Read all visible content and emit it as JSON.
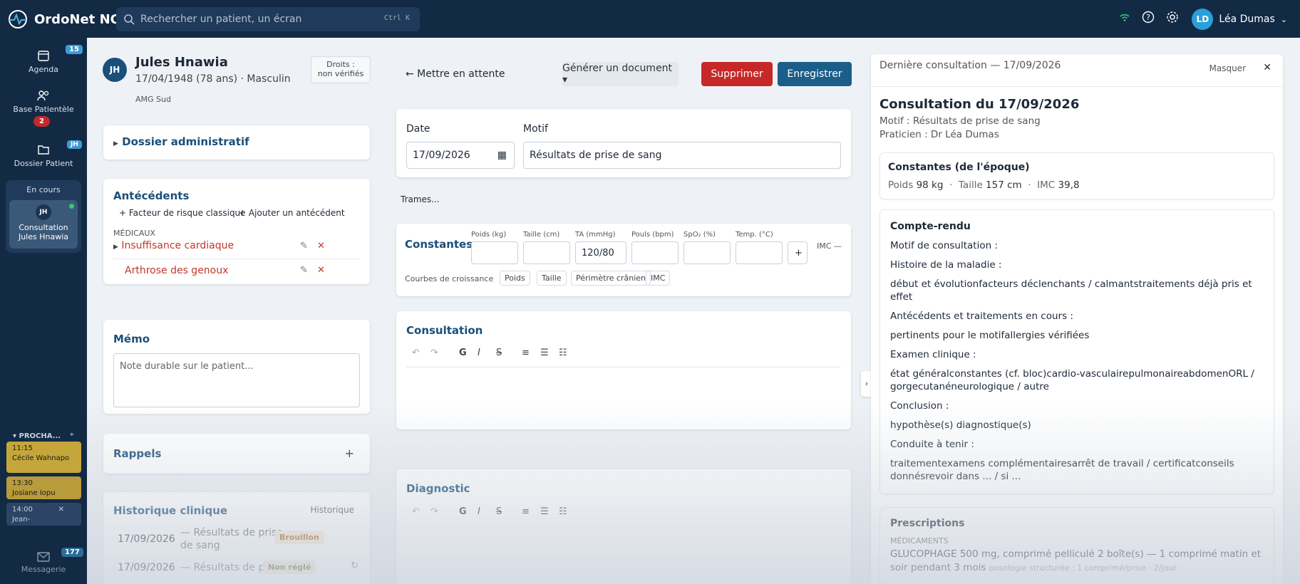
{
  "app": {
    "title": "OrdoNet NC",
    "search_placeholder": "Rechercher un patient, un écran",
    "search_kbd": "Ctrl K",
    "user_initials": "LD",
    "user_name": "Léa Dumas"
  },
  "sidebar": {
    "agenda": "Agenda",
    "agenda_badge": "15",
    "base": "Base Patientèle",
    "base_badge": "2",
    "dossier": "Dossier Patient",
    "dossier_badge": "JH",
    "en_cours": "En cours",
    "current_initials": "JH",
    "current_label1": "Consultation",
    "current_label2": "Jules Hnawia",
    "next_title": "▾ PROCHA...",
    "appointments": [
      {
        "time": "11:15",
        "name": "Cécile Wahnapo"
      },
      {
        "time": "13:30",
        "name": "Josiane Iopu"
      },
      {
        "time": "14:00",
        "name": "Jean-"
      }
    ],
    "messagerie": "Messagerie",
    "messagerie_badge": "177"
  },
  "patient": {
    "initials": "JH",
    "name": "Jules Hnawia",
    "dob": "17/04/1948 (78 ans) · Masculin",
    "coverage": "AMG Sud",
    "rights_label": "Droits :",
    "rights_value": "non vérifiés"
  },
  "left": {
    "dossier_admin": "Dossier administratif",
    "antecedents_title": "Antécédents",
    "add_risk": "+ Facteur de risque classique",
    "add_ante": "+ Ajouter un antécédent",
    "medicaux": "MÉDICAUX",
    "ante1": "Insuffisance cardiaque",
    "ante2": "Arthrose des genoux",
    "memo_title": "Mémo",
    "memo_placeholder": "Note durable sur le patient...",
    "rappels": "Rappels",
    "historique_title": "Historique clinique",
    "historique_link": "Historique",
    "hist": [
      {
        "date": "17/09/2026",
        "text": "— Résultats de prise de sang",
        "status": "Brouillon"
      },
      {
        "date": "17/09/2026",
        "text": "— Résultats de pri...",
        "status": "Non réglé"
      }
    ]
  },
  "center": {
    "hold": "← Mettre en attente",
    "generate": "Générer un document ▾",
    "delete": "Supprimer",
    "save": "Enregistrer",
    "date_label": "Date",
    "date_value": "17/09/2026",
    "motif_label": "Motif",
    "motif_value": "Résultats de prise de sang",
    "trames": "Trames...",
    "constantes_title": "Constantes",
    "const_labels": [
      "Poids (kg)",
      "Taille (cm)",
      "TA (mmHg)",
      "Pouls (bpm)",
      "SpO₂ (%)",
      "Temp. (°C)"
    ],
    "ta_value": "120/80",
    "imc": "IMC —",
    "courbes": "Courbes de croissance",
    "curves": [
      "Poids",
      "Taille",
      "Périmètre crânien",
      "IMC"
    ],
    "consultation_title": "Consultation",
    "diagnostic_title": "Diagnostic"
  },
  "right": {
    "header": "Dernière consultation — 17/09/2026",
    "hide": "Masquer",
    "title": "Consultation du 17/09/2026",
    "motif": "Motif : Résultats de prise de sang",
    "praticien": "Praticien : Dr Léa Dumas",
    "const_title": "Constantes (de l'époque)",
    "poids_label": "Poids",
    "poids": "98 kg",
    "taille_label": "Taille",
    "taille": "157 cm",
    "imc_label": "IMC",
    "imc": "39,8",
    "cr_title": "Compte-rendu",
    "cr_lines": [
      "Motif de consultation :",
      "Histoire de la maladie :",
      "début et évolutionfacteurs déclenchants / calmantstraitements déjà pris et effet",
      "Antécédents et traitements en cours :",
      "pertinents pour le motifallergies vérifiées",
      "Examen clinique :",
      "état généralconstantes (cf. bloc)cardio-vasculairepulmonaireabdomenORL / gorgecutanéneurologique / autre",
      "Conclusion :",
      "hypothèse(s) diagnostique(s)",
      "Conduite à tenir :",
      "traitementexamens complémentairesarrêt de travail / certificatconseils donnésrevoir dans ... / si ..."
    ],
    "presc_title": "Prescriptions",
    "medicaments": "MÉDICAMENTS",
    "presc_line": "GLUCOPHAGE 500 mg, comprimé pelliculé 2 boîte(s) — 1 comprimé matin et soir pendant 3 mois",
    "presc_note": "posologie structurée : 1 comprimé/prise · 2/jour"
  }
}
